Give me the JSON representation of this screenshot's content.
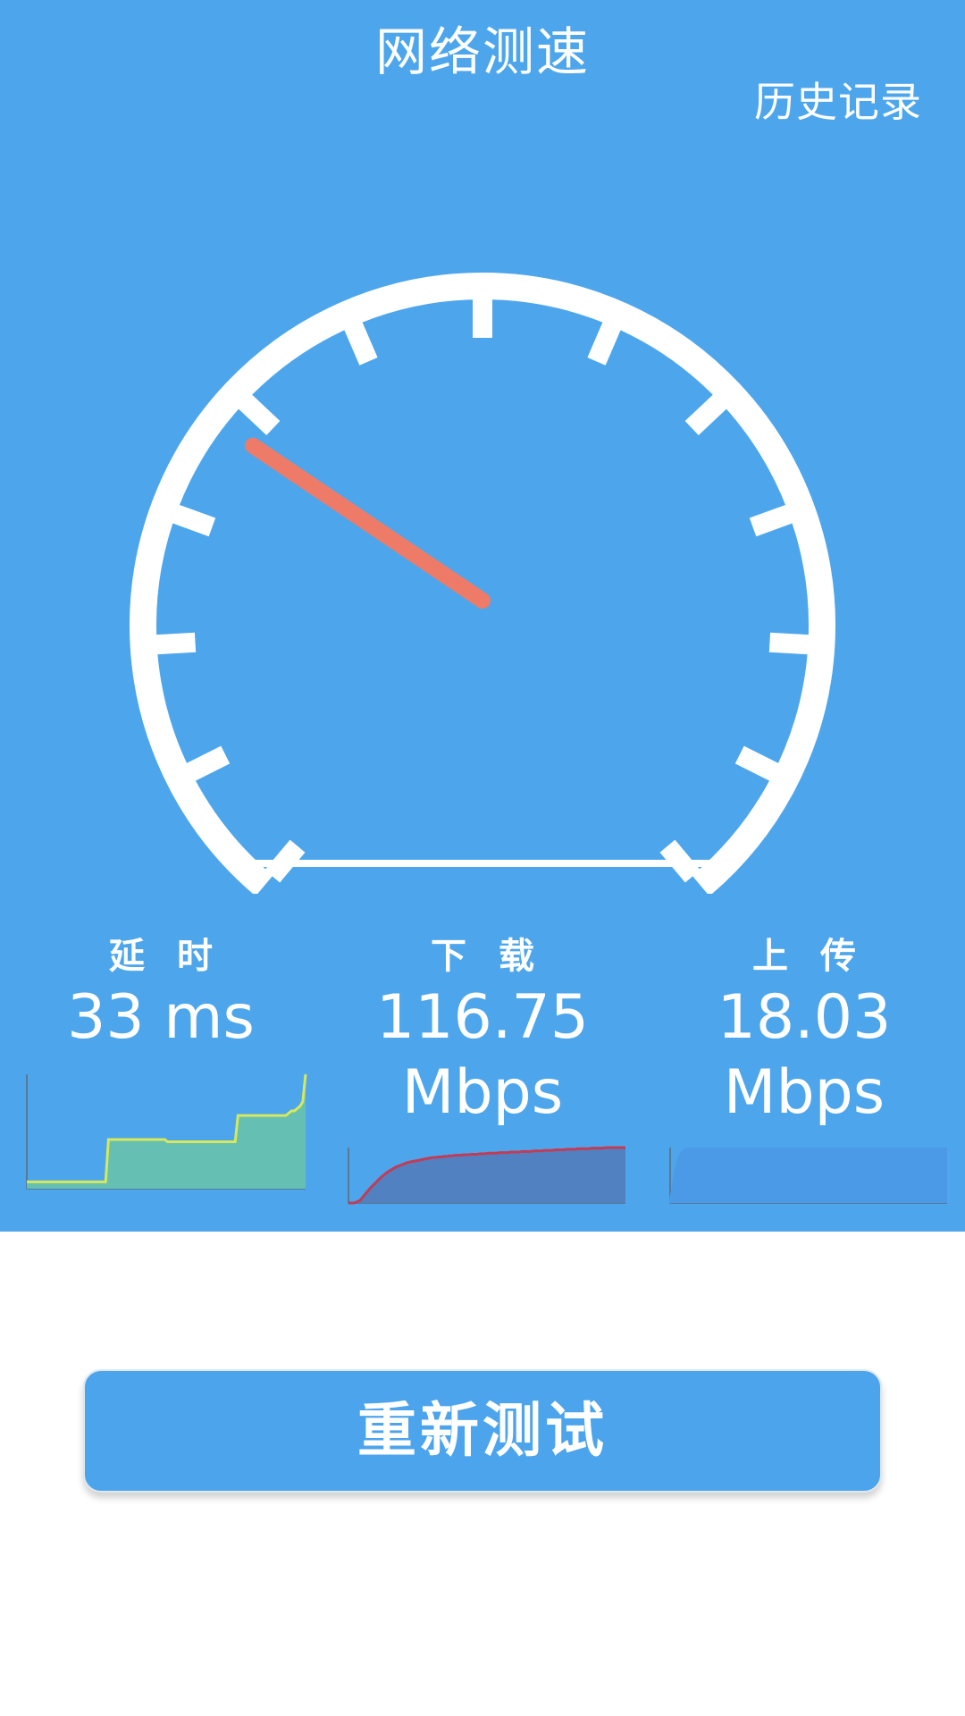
{
  "header": {
    "title": "网络测速",
    "history_label": "历史记录"
  },
  "gauge": {
    "needle_fraction": 0.3
  },
  "stats": {
    "latency": {
      "label": "延时",
      "value": "33 ms",
      "unit": ""
    },
    "download": {
      "label": "下载",
      "value": "116.75",
      "unit": "Mbps"
    },
    "upload": {
      "label": "上传",
      "value": "18.03",
      "unit": "Mbps"
    }
  },
  "sparklines": {
    "latency": {
      "stroke": "#d7e85b",
      "fill": "#66bfb3",
      "values": [
        0.06,
        0.06,
        0.06,
        0.06,
        0.06,
        0.06,
        0.06,
        0.06,
        0.06,
        0.06,
        0.06,
        0.06,
        0.06,
        0.06,
        0.06,
        0.06,
        0.06,
        0.06,
        0.06,
        0.06,
        0.06,
        0.06,
        0.06,
        0.06,
        0.06,
        0.06,
        0.06,
        0.06,
        0.06,
        0.43,
        0.43,
        0.43,
        0.43,
        0.43,
        0.43,
        0.43,
        0.43,
        0.43,
        0.43,
        0.43,
        0.43,
        0.43,
        0.43,
        0.43,
        0.43,
        0.43,
        0.43,
        0.43,
        0.43,
        0.43,
        0.41,
        0.41,
        0.41,
        0.41,
        0.41,
        0.41,
        0.41,
        0.41,
        0.41,
        0.41,
        0.41,
        0.41,
        0.41,
        0.41,
        0.41,
        0.41,
        0.41,
        0.41,
        0.41,
        0.41,
        0.41,
        0.41,
        0.41,
        0.41,
        0.41,
        0.64,
        0.64,
        0.64,
        0.64,
        0.64,
        0.64,
        0.64,
        0.64,
        0.64,
        0.64,
        0.64,
        0.64,
        0.64,
        0.64,
        0.64,
        0.64,
        0.64,
        0.64,
        0.66,
        0.68,
        0.68,
        0.7,
        0.72,
        0.76,
        1.0
      ]
    },
    "download": {
      "stroke": "#c23c56",
      "fill": "#5181c0",
      "values": [
        0.0,
        0.0,
        0.0,
        0.02,
        0.04,
        0.1,
        0.16,
        0.22,
        0.28,
        0.33,
        0.38,
        0.43,
        0.48,
        0.52,
        0.56,
        0.59,
        0.62,
        0.65,
        0.67,
        0.69,
        0.71,
        0.73,
        0.74,
        0.75,
        0.76,
        0.77,
        0.78,
        0.79,
        0.8,
        0.81,
        0.82,
        0.82,
        0.83,
        0.83,
        0.84,
        0.84,
        0.85,
        0.85,
        0.86,
        0.86,
        0.86,
        0.87,
        0.87,
        0.87,
        0.88,
        0.88,
        0.88,
        0.89,
        0.89,
        0.89,
        0.9,
        0.9,
        0.9,
        0.9,
        0.91,
        0.91,
        0.91,
        0.91,
        0.92,
        0.92,
        0.92,
        0.92,
        0.93,
        0.93,
        0.93,
        0.93,
        0.94,
        0.94,
        0.94,
        0.94,
        0.95,
        0.95,
        0.95,
        0.95,
        0.96,
        0.96,
        0.96,
        0.96,
        0.97,
        0.97,
        0.97,
        0.97,
        0.98,
        0.98,
        0.98,
        0.98,
        0.98,
        0.99,
        0.99,
        0.99,
        0.99,
        0.99,
        1.0,
        1.0,
        1.0,
        1.0,
        1.0,
        1.0,
        1.0,
        1.0
      ]
    },
    "upload": {
      "stroke": "#4b9ae8",
      "fill": "#4b9ae8",
      "values": [
        0.0,
        0.3,
        0.6,
        0.8,
        0.9,
        0.95,
        0.97,
        0.98,
        0.98,
        0.98,
        0.98,
        0.98,
        0.98,
        0.98,
        0.98,
        0.98,
        0.98,
        0.98,
        0.98,
        0.98,
        0.98,
        0.98,
        0.98,
        0.98,
        0.98,
        0.98,
        0.98,
        0.98,
        0.98,
        0.98,
        0.98,
        0.98,
        0.98,
        0.98,
        0.98,
        0.98,
        0.98,
        0.98,
        0.98,
        0.98,
        0.98,
        0.98,
        0.98,
        0.98,
        0.98,
        0.98,
        0.98,
        0.98,
        0.98,
        0.98,
        0.98,
        0.98,
        0.98,
        0.98,
        0.98,
        0.98,
        0.98,
        0.98,
        0.98,
        0.98,
        0.98,
        0.98,
        0.98,
        0.98,
        0.98,
        0.98,
        0.98,
        0.98,
        0.98,
        0.98,
        0.98,
        0.98,
        0.98,
        0.98,
        0.98,
        0.98,
        0.98,
        0.98,
        0.98,
        0.98,
        0.98,
        0.98,
        0.98,
        0.98,
        0.98,
        0.98,
        0.98,
        0.98,
        0.98,
        0.98,
        0.98,
        0.98,
        0.98,
        0.98,
        0.98,
        0.98,
        0.98,
        0.98,
        0.98,
        0.98
      ]
    }
  },
  "actions": {
    "retest_label": "重新测试"
  },
  "colors": {
    "panel_bg": "#4da6ec",
    "needle": "#ee7b67",
    "button_bg": "#4ca4ec"
  }
}
